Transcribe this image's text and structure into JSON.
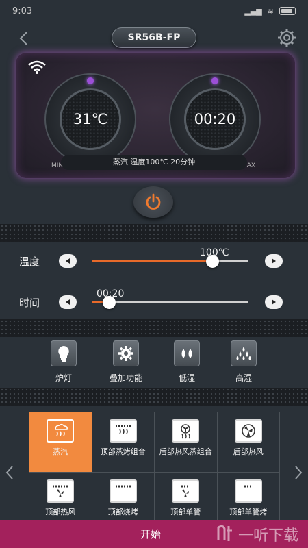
{
  "status_bar": {
    "time": "9:03"
  },
  "header": {
    "device_name": "SR56B-FP"
  },
  "display": {
    "temperature": "31℃",
    "timer": "00:20",
    "min_label": "MIN",
    "max_label": "MAX",
    "mode_info": "蒸汽 温度100℃ 20分钟"
  },
  "sliders": {
    "temperature": {
      "label": "温度",
      "value": "100℃",
      "fraction": 0.77
    },
    "time": {
      "label": "时间",
      "value": "00:20",
      "fraction": 0.11
    }
  },
  "functions": [
    {
      "label": "炉灯",
      "icon": "bulb-icon"
    },
    {
      "label": "叠加功能",
      "icon": "gear-icon"
    },
    {
      "label": "低湿",
      "icon": "two-drops-icon"
    },
    {
      "label": "高湿",
      "icon": "many-drops-icon"
    }
  ],
  "modes": [
    {
      "label": "蒸汽",
      "icon": "steam-icon",
      "active": true
    },
    {
      "label": "顶部蒸烤组合",
      "icon": "top-steam-icon",
      "active": false
    },
    {
      "label": "后部热风蒸组合",
      "icon": "back-fan-steam-icon",
      "active": false
    },
    {
      "label": "后部热风",
      "icon": "back-fan-icon",
      "active": false
    },
    {
      "label": "顶部热风",
      "icon": "top-fan-icon",
      "active": false
    },
    {
      "label": "顶部烧烤",
      "icon": "top-grill-icon",
      "active": false
    },
    {
      "label": "顶部单管",
      "icon": "top-single-fan-icon",
      "active": false
    },
    {
      "label": "顶部单管烤",
      "icon": "top-single-grill-icon",
      "active": false
    }
  ],
  "start": {
    "label": "开始"
  },
  "watermark": {
    "text": "一听下载"
  },
  "colors": {
    "accent": "#f28a3f",
    "start_bar": "#a3215c",
    "glow": "#b56cff"
  }
}
